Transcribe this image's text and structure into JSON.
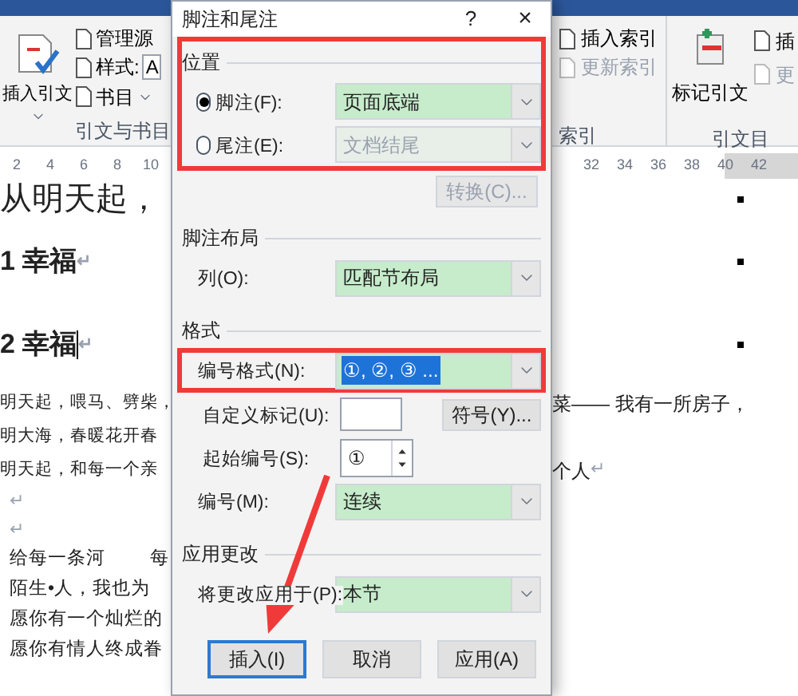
{
  "ribbon": {
    "left": {
      "big_button": "插入引文",
      "items": [
        {
          "kind": "button",
          "label": "管理源"
        },
        {
          "kind": "dropdown",
          "label": "样式:",
          "value": "A"
        },
        {
          "kind": "menu",
          "label": "书目"
        }
      ],
      "group_label": "引文与书目"
    },
    "right": {
      "index_items": [
        {
          "label": "插入索引",
          "disabled": false
        },
        {
          "label": "更新索引",
          "disabled": true
        }
      ],
      "index_label": "索引",
      "big_button": "标记引文",
      "toa_items": [
        {
          "label": "插",
          "disabled": false
        },
        {
          "label": "更",
          "disabled": true
        }
      ],
      "toa_label": "引文目"
    }
  },
  "ruler": {
    "left_ticks": [
      "2",
      "4",
      "6",
      "8",
      "10"
    ],
    "right_ticks": [
      "32",
      "34",
      "36",
      "38",
      "40",
      "42"
    ]
  },
  "document": {
    "rows": [
      {
        "kind": "title",
        "left": "从明天起，"
      },
      {
        "kind": "heading",
        "left": "1  幸福",
        "mark": "↵",
        "cursor": false
      },
      {
        "kind": "heading",
        "left": "2  幸福",
        "mark": "↵",
        "cursor": true
      },
      {
        "kind": "body",
        "left": "明天起，喂马、劈柴，",
        "right": "菜—— 我有一所房子，"
      },
      {
        "kind": "body",
        "left": "明大海，春暖花开春"
      },
      {
        "kind": "body",
        "left": "明天起，和每一个亲",
        "right": "个人",
        "mark": "↵"
      },
      {
        "kind": "empty",
        "mark": "↵"
      },
      {
        "kind": "empty",
        "mark": "↵"
      },
      {
        "kind": "poem",
        "segments": [
          "给每一条河",
          "每"
        ]
      },
      {
        "kind": "poem",
        "segments": [
          "陌生•人，我也为"
        ]
      },
      {
        "kind": "poem",
        "segments": [
          "愿你有一个灿烂的"
        ]
      },
      {
        "kind": "poem",
        "segments": [
          "愿你有情人终成眷"
        ]
      }
    ]
  },
  "dialog": {
    "title": "脚注和尾注",
    "help": "?",
    "close": "×",
    "sections": [
      {
        "heading": "位置",
        "highlighted": true,
        "rows": [
          {
            "kind": "radio",
            "label": "脚注(F):",
            "selected": true,
            "value": "页面底端",
            "disabled": false
          },
          {
            "kind": "radio",
            "label": "尾注(E):",
            "selected": false,
            "value": "文档结尾",
            "disabled": true
          }
        ],
        "button": {
          "label": "转换(C)...",
          "disabled": true
        }
      },
      {
        "heading": "脚注布局",
        "highlighted": false,
        "rows": [
          {
            "kind": "select",
            "label": "列(O):",
            "value": "匹配节布局",
            "highlighted": false,
            "value_selected": false
          }
        ]
      },
      {
        "heading": "格式",
        "highlighted": false,
        "rows": [
          {
            "kind": "select",
            "label": "编号格式(N):",
            "value": "①, ②, ③ ...",
            "highlighted": true,
            "value_selected": true
          },
          {
            "kind": "text",
            "label": "自定义标记(U):",
            "button": "符号(Y)..."
          },
          {
            "kind": "spin",
            "label": "起始编号(S):",
            "value": "①"
          },
          {
            "kind": "select",
            "label": "编号(M):",
            "value": "连续",
            "highlighted": false,
            "value_selected": false
          }
        ]
      },
      {
        "heading": "应用更改",
        "highlighted": false,
        "rows": [
          {
            "kind": "select",
            "label": "将更改应用于(P):",
            "value": "本节",
            "highlighted": false,
            "value_selected": false
          }
        ]
      }
    ],
    "buttons": [
      {
        "label": "插入(I)",
        "focused": true
      },
      {
        "label": "取消",
        "focused": false
      },
      {
        "label": "应用(A)",
        "focused": false
      }
    ]
  }
}
